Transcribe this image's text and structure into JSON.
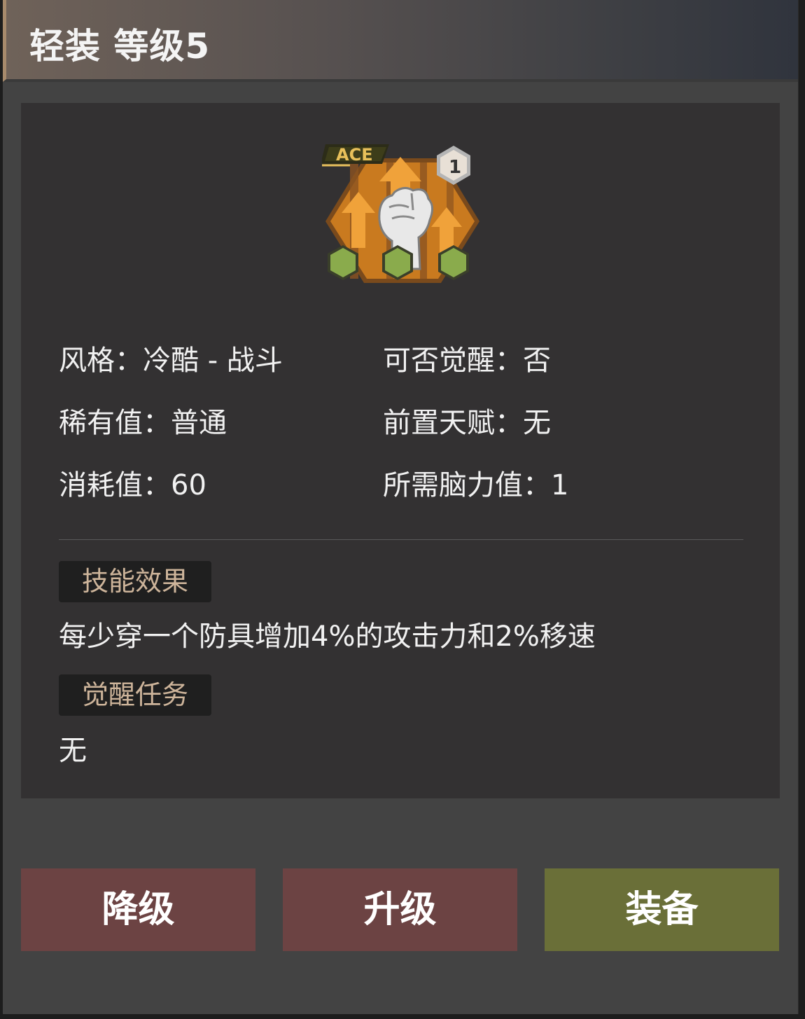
{
  "header": {
    "title": "轻装 等级5"
  },
  "icon": {
    "name": "fist-skill-icon",
    "badge_text": "ACE",
    "level_badge": "1"
  },
  "stats": {
    "style": {
      "label": "风格：",
      "value": "冷酷 - 战斗"
    },
    "awaken": {
      "label": "可否觉醒：",
      "value": "否"
    },
    "rarity": {
      "label": "稀有值：",
      "value": "普通"
    },
    "prereq": {
      "label": "前置天赋：",
      "value": "无"
    },
    "cost": {
      "label": "消耗值：",
      "value": "60"
    },
    "brain": {
      "label": "所需脑力值：",
      "value": "1"
    }
  },
  "effect": {
    "tag": "技能效果",
    "text": "每少穿一个防具增加4%的攻击力和2%移速"
  },
  "awaken_task": {
    "tag": "觉醒任务",
    "text": "无"
  },
  "buttons": {
    "downgrade": "降级",
    "upgrade": "升级",
    "equip": "装备"
  },
  "colors": {
    "red_button": "#6c4343",
    "olive_button": "#6a6f38",
    "tag_text": "#cdb49a"
  }
}
